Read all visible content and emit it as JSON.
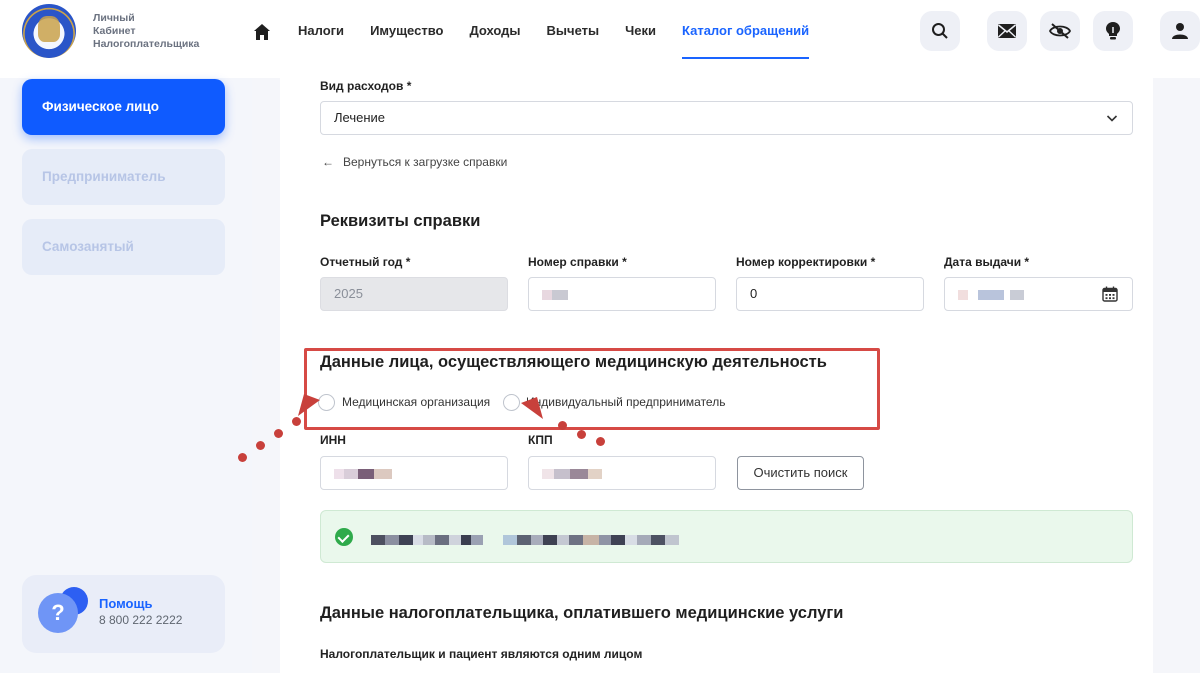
{
  "header": {
    "brand_line1": "Личный",
    "brand_line2": "Кабинет",
    "brand_line3": "Налогоплательщика",
    "nav": [
      "Налоги",
      "Имущество",
      "Доходы",
      "Вычеты",
      "Чеки",
      "Каталог обращений"
    ],
    "active_nav": "Каталог обращений",
    "icons": [
      "search-icon",
      "mail-icon",
      "eye-off-icon",
      "bulb-icon",
      "user-icon"
    ]
  },
  "sidebar": {
    "items": [
      {
        "label": "Физическое лицо",
        "active": true
      },
      {
        "label": "Предприниматель",
        "active": false
      },
      {
        "label": "Самозанятый",
        "active": false
      }
    ],
    "help_title": "Помощь",
    "help_phone": "8 800 222 2222"
  },
  "form": {
    "expense_type_label": "Вид расходов *",
    "expense_type_value": "Лечение",
    "back_link": "Вернуться к загрузке справки",
    "requisites_title": "Реквизиты справки",
    "year_label": "Отчетный год *",
    "year_value": "2025",
    "cert_number_label": "Номер справки *",
    "correction_label": "Номер корректировки *",
    "correction_value": "0",
    "issue_date_label": "Дата выдачи *",
    "medical_title": "Данные лица, осуществляющего медицинскую деятельность",
    "radio_org": "Медицинская организация",
    "radio_ip": "Индивидуальный предприниматель",
    "inn_label": "ИНН",
    "kpp_label": "КПП",
    "clear_search": "Очистить поиск",
    "payer_title": "Данные налогоплательщика, оплатившего медицинские услуги",
    "payer_same_label": "Налогоплательщик и пациент являются одним лицом"
  },
  "colors": {
    "accent": "#1a64ff",
    "annotation_red": "#d64a45",
    "success_green": "#2faa4b"
  }
}
